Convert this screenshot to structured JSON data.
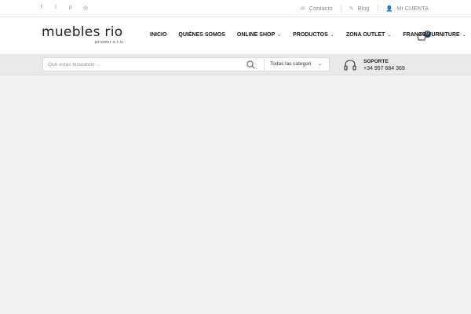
{
  "topbar": {
    "social": [
      {
        "icon": "facebook-icon",
        "glyph": "f"
      },
      {
        "icon": "twitter-icon",
        "glyph": "t"
      },
      {
        "icon": "pinterest-icon",
        "glyph": "p"
      },
      {
        "icon": "instagram-icon",
        "glyph": "◎"
      }
    ],
    "links": [
      {
        "icon": "mail-icon",
        "glyph": "✉",
        "label": "Contacto"
      },
      {
        "icon": "blog-icon",
        "glyph": "✎",
        "label": "Blog"
      },
      {
        "icon": "user-icon",
        "glyph": "👤",
        "label": "MI CUENTA"
      }
    ]
  },
  "header": {
    "logo_main": "muebles rio",
    "logo_sub": "priomu s.l.u.",
    "nav": [
      {
        "label": "INICIO",
        "has_dropdown": false
      },
      {
        "label": "QUIÉNES SOMOS",
        "has_dropdown": false
      },
      {
        "label": "ONLINE SHOP",
        "has_dropdown": true
      },
      {
        "label": "PRODUCTOS",
        "has_dropdown": true
      },
      {
        "label": "ZONA OUTLET",
        "has_dropdown": true
      },
      {
        "label": "FRANCO FURNITURE",
        "has_dropdown": true
      }
    ],
    "cart_count": "0"
  },
  "search": {
    "placeholder": "Qué estás buscando ...",
    "category_label": "Todas las categori"
  },
  "support": {
    "label": "SOPORTE",
    "phone": "+34 957 684 369"
  },
  "colors": {
    "accent": "#2b3b55",
    "search_band": "#e9e9e9",
    "page_bg": "#f1f1f1"
  }
}
